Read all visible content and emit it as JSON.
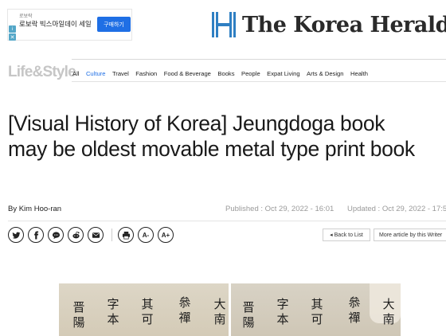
{
  "ad": {
    "sponsor": "로보락",
    "text": "로보락 빅스마일데이 세일",
    "button": "구매하기",
    "info_icon": "i",
    "close_icon": "✕"
  },
  "logo": {
    "text": "The Korea Herald",
    "mark": "H"
  },
  "section_logo": "Life&Style",
  "nav": {
    "items": [
      "All",
      "Culture",
      "Travel",
      "Fashion",
      "Food & Beverage",
      "Books",
      "People",
      "Expat Living",
      "Arts & Design",
      "Health"
    ],
    "active": "Culture",
    "active_color": "#1f6fe5"
  },
  "article": {
    "headline": "[Visual History of Korea] Jeungdoga book may be oldest movable metal type print book",
    "byline": "By Kim Hoo-ran",
    "published": "Published : Oct 29, 2022 - 16:01",
    "updated": "Updated : Oct 29, 2022 - 17:5"
  },
  "share": {
    "twitter": "twitter-icon",
    "facebook": "facebook-icon",
    "talk": "talk-icon",
    "reddit": "reddit-icon",
    "email": "email-icon",
    "print": "print-icon",
    "font_down": "A-",
    "font_up": "A+"
  },
  "buttons": {
    "back": "◂ Back to List",
    "more": "More article by this Writer"
  },
  "photo": {
    "left_cols": [
      [
        "大",
        "南"
      ],
      [
        "叅",
        "禪"
      ],
      [
        "其",
        "可"
      ],
      [
        "字",
        "本"
      ],
      [
        "晋",
        "陽"
      ]
    ],
    "right_cols": [
      [
        "大",
        "南"
      ],
      [
        "叅",
        "禪"
      ],
      [
        "其",
        "可"
      ],
      [
        "字",
        "本"
      ],
      [
        "晋",
        "陽"
      ]
    ]
  }
}
